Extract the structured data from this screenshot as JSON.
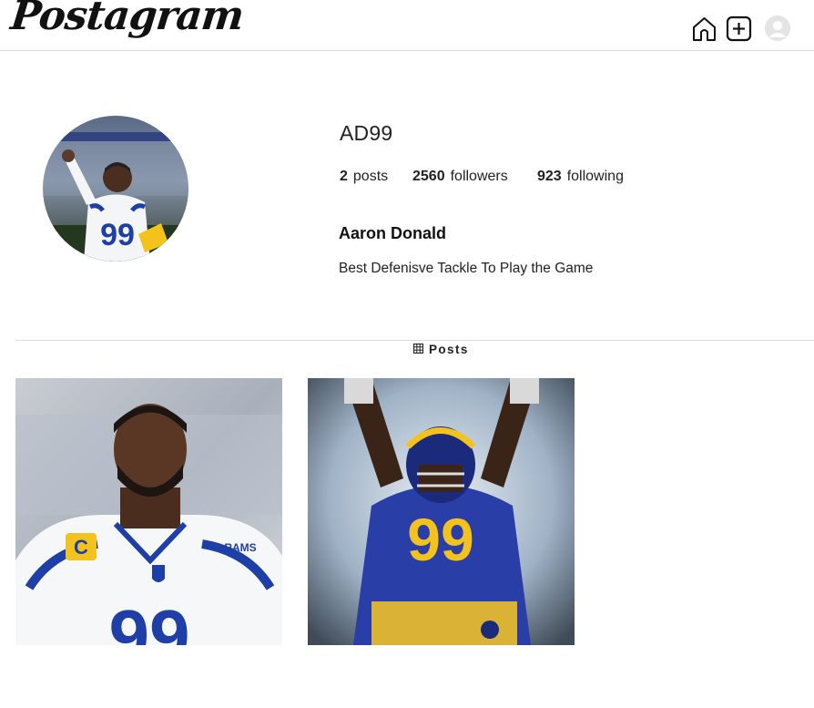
{
  "header": {
    "logo_text": "Postagram",
    "icons": [
      "home-icon",
      "add-post-icon",
      "avatar-icon"
    ]
  },
  "profile": {
    "username": "AD99",
    "stats": {
      "posts_count": "2",
      "posts_label": "posts",
      "followers_count": "2560",
      "followers_label": "followers",
      "following_count": "923",
      "following_label": "following"
    },
    "full_name": "Aaron Donald",
    "bio": "Best Defenisve Tackle To Play the Game"
  },
  "tabs": {
    "posts_label": "Posts"
  },
  "colors": {
    "rams_blue": "#1f3fa8",
    "rams_gold": "#f3c21c",
    "divider": "#dbdbdb"
  }
}
